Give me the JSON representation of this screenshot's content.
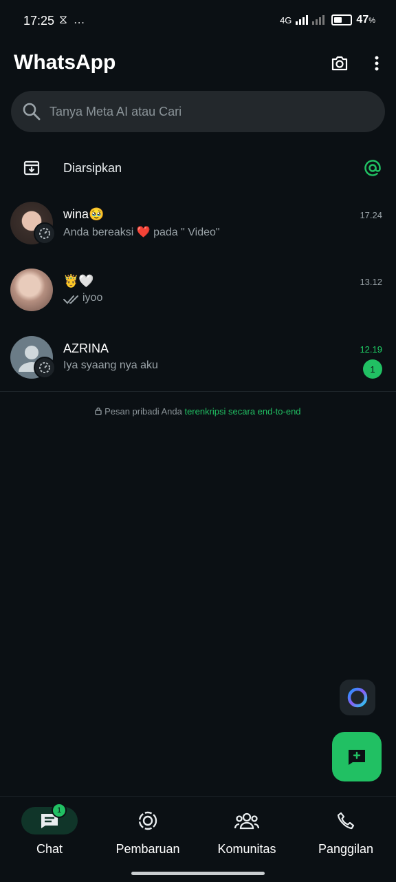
{
  "status_bar": {
    "time": "17:25",
    "left_icons": "⧖ …",
    "network_1": "4G",
    "battery": "47",
    "battery_unit": "%"
  },
  "header": {
    "title": "WhatsApp"
  },
  "search": {
    "placeholder": "Tanya Meta AI atau Cari"
  },
  "archived": {
    "label": "Diarsipkan"
  },
  "chats": [
    {
      "name": "wina🥹",
      "message": "Anda bereaksi ❤️ pada \" Video\"",
      "time": "17.24"
    },
    {
      "name": "🤴🤍",
      "message": "iyoo",
      "time": "13.12"
    },
    {
      "name": "AZRINA",
      "message": "Iya syaang nya aku",
      "time": "12.19",
      "unread": "1"
    }
  ],
  "encryption": {
    "text": "Pesan pribadi Anda ",
    "link": "terenkripsi secara end-to-end"
  },
  "nav": {
    "chat": "Chat",
    "chat_badge": "1",
    "updates": "Pembaruan",
    "communities": "Komunitas",
    "calls": "Panggilan"
  },
  "colors": {
    "accent": "#21c063",
    "background": "#0b1014",
    "search_bg": "#23282c"
  }
}
